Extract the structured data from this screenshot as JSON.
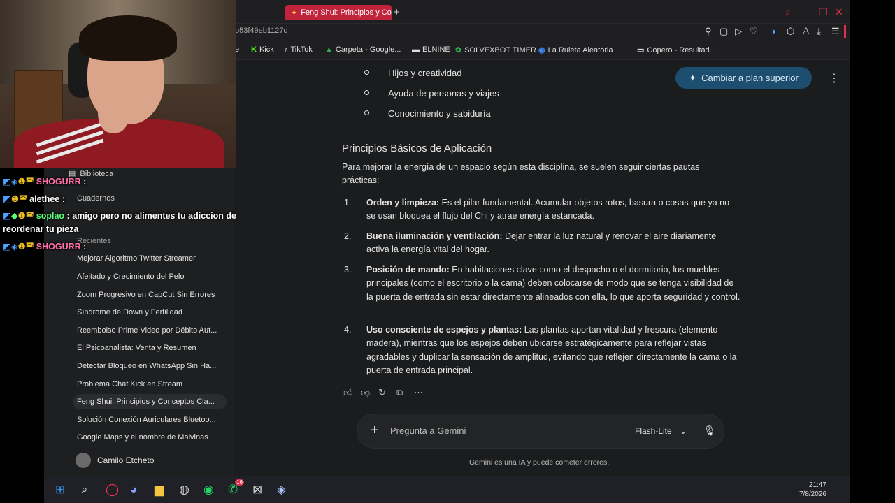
{
  "browser": {
    "tab_title": "Feng Shui: Principios y Con",
    "url_fragment": "b53f49eb1127c",
    "bookmarks": [
      "e",
      "Kick",
      "TikTok",
      "Carpeta - Google...",
      "ELNINE",
      "SOLVEXBOT TIMER",
      "La Ruleta Aleatoria",
      "Copero - Resultad..."
    ]
  },
  "sidebar": {
    "library_label": "Biblioteca",
    "notebooks_label": "Cuadernos",
    "recent_label": "Recientes",
    "chats": [
      "Mejorar Algoritmo Twitter Streamer",
      "Afeitado y Crecimiento del Pelo",
      "Zoom Progresivo en CapCut Sin Errores",
      "Síndrome de Down y Fertilidad",
      "Reembolso Prime Video por Débito Aut...",
      "El Psicoanalista: Venta y Resumen",
      "Detectar Bloqueo en WhatsApp Sin Ha...",
      "Problema Chat Kick en Stream",
      "Feng Shui: Principios y Conceptos Cla...",
      "Solución Conexión Auriculares Bluetoo...",
      "Google Maps y el nombre de Malvinas"
    ],
    "user_name": "Camilo Etcheto"
  },
  "main": {
    "upgrade_label": "Cambiar a plan superior",
    "bullets": [
      "Hijos y creatividad",
      "Ayuda de personas y viajes",
      "Conocimiento y sabiduría"
    ],
    "section_title": "Principios Básicos de Aplicación",
    "intro": "Para mejorar la energía de un espacio según esta disciplina, se suelen seguir ciertas pautas prácticas:",
    "items": [
      {
        "num": "1.",
        "title": "Orden y limpieza:",
        "text": " Es el pilar fundamental. Acumular objetos rotos, basura o cosas que ya no se usan bloquea el flujo del Chi y atrae energía estancada."
      },
      {
        "num": "2.",
        "title": "Buena iluminación y ventilación:",
        "text": " Dejar entrar la luz natural y renovar el aire diariamente activa la energía vital del hogar."
      },
      {
        "num": "3.",
        "title": "Posición de mando:",
        "text": " En habitaciones clave como el despacho o el dormitorio, los muebles principales (como el escritorio o la cama) deben colocarse de modo que se tenga visibilidad de la puerta de entrada sin estar directamente alineados con ella, lo que aporta seguridad y control."
      },
      {
        "num": "4.",
        "title": "Uso consciente de espejos y plantas:",
        "text": " Las plantas aportan vitalidad y frescura (elemento madera), mientras que los espejos deben ubicarse estratégicamente para reflejar vistas agradables y duplicar la sensación de amplitud, evitando que reflejen directamente la cama o la puerta de entrada principal."
      }
    ],
    "prompt_placeholder": "Pregunta a Gemini",
    "model_label": "Flash-Lite",
    "disclaimer": "Gemini es una IA y puede cometer errores."
  },
  "taskbar": {
    "time": "21:47",
    "date": "7/8/2026",
    "whatsapp_badge": "16"
  },
  "stream_chat": [
    {
      "user": "SHOGURR",
      "msg": ""
    },
    {
      "user": "alethee",
      "msg": ""
    },
    {
      "user": "soplao",
      "msg": "amigo pero no alimentes tu adiccion de"
    },
    {
      "user": "",
      "msg": "reordenar tu pieza"
    },
    {
      "user": "SHOGURR",
      "msg": ""
    }
  ]
}
